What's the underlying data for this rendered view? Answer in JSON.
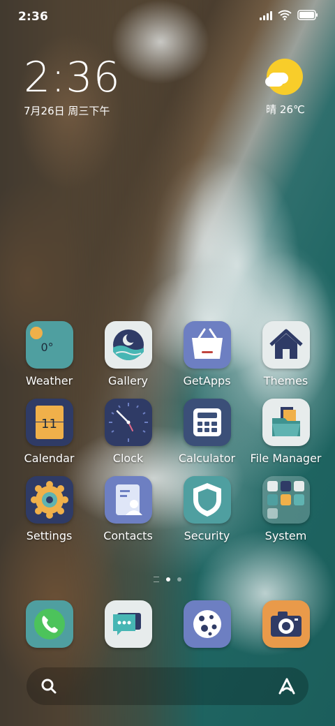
{
  "status_bar": {
    "time": "2:36"
  },
  "clock_widget": {
    "time": "2:36",
    "date": "7月26日 周三下午"
  },
  "weather_widget": {
    "text": "晴 26℃"
  },
  "apps": {
    "weather": "Weather",
    "gallery": "Gallery",
    "getapps": "GetApps",
    "themes": "Themes",
    "calendar": "Calendar",
    "clock": "Clock",
    "calculator": "Calculator",
    "file_manager": "File Manager",
    "settings": "Settings",
    "contacts": "Contacts",
    "security": "Security",
    "system": "System"
  },
  "weather_icon_text": "0°",
  "calendar_icon_text": "11",
  "icons": {
    "search": "search-icon",
    "assistant": "assistant-icon"
  },
  "colors": {
    "weather_bg": "#4f9fa0",
    "sun": "#f8cd2a",
    "navy": "#2f3b66",
    "periwinkle": "#6d7fc2",
    "orange": "#f0b04a"
  }
}
